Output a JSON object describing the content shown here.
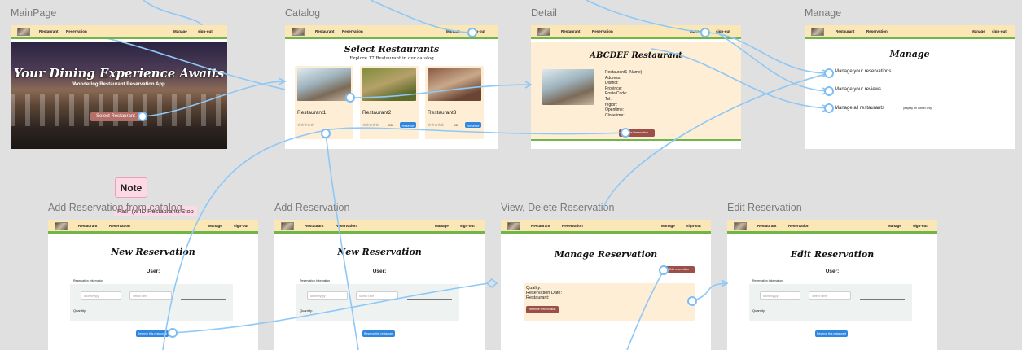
{
  "nav": {
    "restaurant": "Restaurant",
    "reservation": "Reservation",
    "manage": "Manage",
    "signout": "sign-out"
  },
  "frames": {
    "mainpage": {
      "label": "MainPage",
      "hero_title": "Your Dining Experience Awaits",
      "hero_subtitle": "Wondering Restaurant Reservation App",
      "cta": "Select Restaurant"
    },
    "catalog": {
      "label": "Catalog",
      "title": "Select Restaurants",
      "subtitle": "Explore 17 Restaurant in our catalog",
      "cards": [
        {
          "name": "Restaurant1",
          "stars": "☆☆☆☆☆"
        },
        {
          "name": "Restaurant2",
          "stars": "☆☆☆☆☆",
          "extra": "0/5",
          "btn": "Reserve"
        },
        {
          "name": "Restaurant3",
          "stars": "☆☆☆☆☆",
          "extra": "0/5",
          "btn": "Reserve"
        }
      ]
    },
    "detail": {
      "label": "Detail",
      "title": "ABCDEF Restaurant",
      "lines": [
        "Restaurant1 (Name)",
        "Address:",
        "District:",
        "Province:",
        "PostalCode:",
        "Tel:",
        "region:",
        "Opentime:",
        "Closetime:"
      ],
      "btn": "Make Reservation"
    },
    "manage": {
      "label": "Manage",
      "title": "Manage",
      "items": [
        "Manage your reservations",
        "Manage your reviews",
        "Manage all restaurants"
      ],
      "admin_note": "(display for admin only)"
    },
    "add_from_catalog": {
      "label": "Add Reservation from catalog",
      "title": "New Reservation",
      "user": "User:",
      "info": "Reservation Information",
      "date_ph": "dd/mm/yyyy",
      "time_ph": "Select Time",
      "quantity": "Quantity:",
      "btn": "Reserve this restaurant"
    },
    "add": {
      "label": "Add Reservation",
      "title": "New Reservation",
      "user": "User:",
      "info": "Reservation Information",
      "date_ph": "dd/mm/yyyy",
      "time_ph": "Select Time",
      "quantity": "Quantity:",
      "btn": "Reserve this restaurant"
    },
    "view": {
      "label": "View, Delete Reservation",
      "title": "Manage Reservation",
      "edit_btn": "Edit reservation",
      "lines": [
        "Quality:",
        "Reservation Date:",
        "Restaurant:"
      ],
      "remove_btn": "Remove Reservation"
    },
    "edit": {
      "label": "Edit Reservation",
      "title": "Edit Reservation",
      "user": "User:",
      "info": "Reservation Information",
      "date_ph": "dd/mm/yyyy",
      "time_ph": "Select Time",
      "quantity": "Quantity:",
      "btn": "Reserve this restaurant"
    }
  },
  "note": {
    "title": "Note",
    "text": "Path (w ID Restaurant) Stop"
  },
  "colors": {
    "nav_bg": "#fbe7b6",
    "nav_border": "#6fb548",
    "card_bg": "#fdeed5",
    "btn_blue": "#2f86e0",
    "btn_red": "#9c4f48",
    "wire": "#8ec8f7"
  }
}
